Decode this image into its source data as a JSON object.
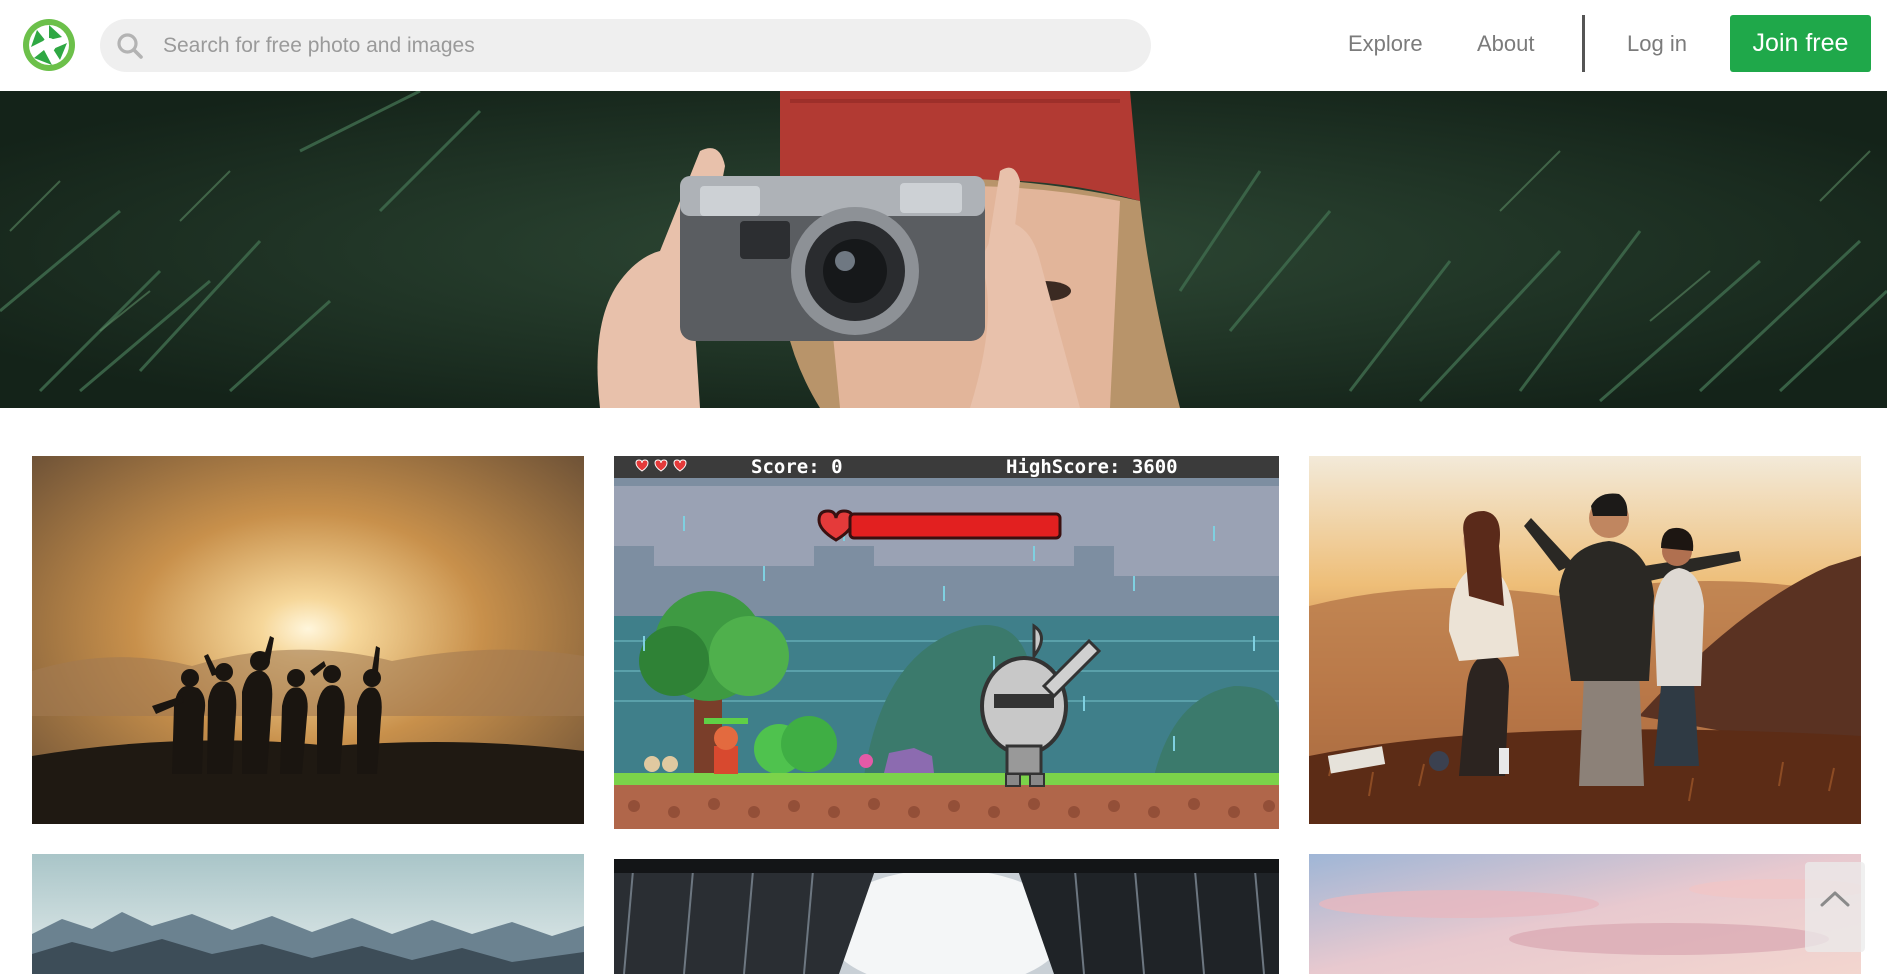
{
  "header": {
    "search": {
      "placeholder": "Search for free photo and images"
    },
    "nav": {
      "explore": "Explore",
      "about": "About",
      "login": "Log in",
      "join": "Join free"
    }
  },
  "gallery": {
    "game": {
      "score_label": "Score: 0",
      "highscore_label": "HighScore: 3600",
      "hearts": 3
    }
  },
  "colors": {
    "brand_green": "#1fa84a",
    "search_bg": "#efefef",
    "nav_text": "#7b7b7b"
  },
  "icons": [
    "aperture-logo-icon",
    "search-icon",
    "chevron-up-icon"
  ]
}
